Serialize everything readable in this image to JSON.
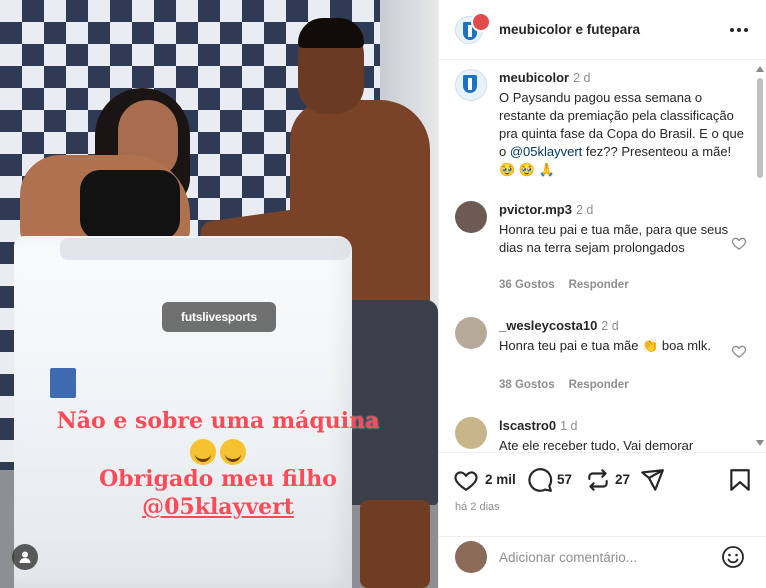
{
  "media": {
    "watermark": "futslivesports",
    "caption_line1": "Não  e sobre  uma máquina",
    "caption_line2": "Obrigado meu filho",
    "caption_line3": "@05klayvert"
  },
  "header": {
    "username": "meubicolor",
    "conjunction": " e ",
    "collaborator": "futepara"
  },
  "post": {
    "username": "meubicolor",
    "time": "2 d",
    "text_before_mention": "O Paysandu pagou essa semana o restante da premiação pela classificação pra quinta fase da Copa do Brasil. E o que o ",
    "mention": "@05klayvert",
    "text_after_mention": " fez?? Presenteou a mãe! 🥹 🥹 🙏"
  },
  "comments": [
    {
      "username": "pvictor.mp3",
      "time": "2 d",
      "text": "Honra teu pai e tua mãe, para que seus dias na terra sejam prolongados",
      "likes": "36 Gostos",
      "reply": "Responder"
    },
    {
      "username": "_wesleycosta10",
      "time": "2 d",
      "text": "Honra teu pai e tua mãe 👏 boa mlk.",
      "likes": "38 Gostos",
      "reply": "Responder"
    },
    {
      "username": "lscastro0",
      "time": "1 d",
      "text": "Ate ele receber tudo, Vai demorar"
    }
  ],
  "actions": {
    "likes": "2 mil",
    "comments": "57",
    "reposts": "27",
    "date": "há 2 dias"
  },
  "add_comment": {
    "placeholder": "Adicionar comentário..."
  },
  "colors": {
    "caption": "#ff4b57",
    "club_blue": "#1c73c4",
    "mention": "#00376b",
    "muted": "#8e8e8e"
  }
}
